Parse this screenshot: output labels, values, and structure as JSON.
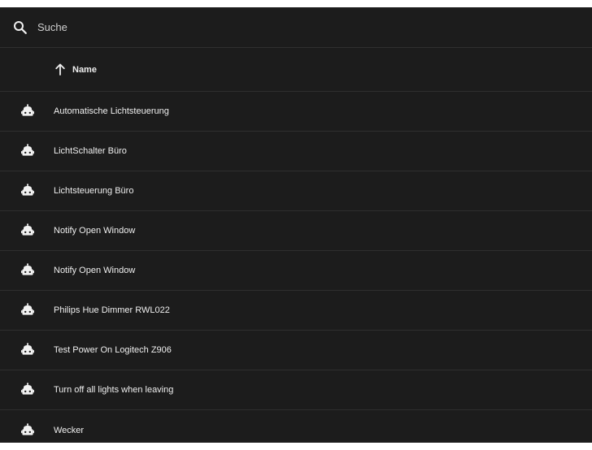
{
  "search": {
    "placeholder": "Suche"
  },
  "table": {
    "columns": [
      {
        "label": "Name",
        "sort": "ascending"
      }
    ],
    "rows": [
      {
        "name": "Automatische Lichtsteuerung",
        "icon": "robot-icon"
      },
      {
        "name": "LichtSchalter Büro",
        "icon": "robot-icon"
      },
      {
        "name": "Lichtsteuerung Büro",
        "icon": "robot-icon"
      },
      {
        "name": "Notify Open Window",
        "icon": "robot-icon"
      },
      {
        "name": "Notify Open Window",
        "icon": "robot-icon"
      },
      {
        "name": "Philips Hue Dimmer RWL022",
        "icon": "robot-icon"
      },
      {
        "name": "Test Power On Logitech Z906",
        "icon": "robot-icon"
      },
      {
        "name": "Turn off all lights when leaving",
        "icon": "robot-icon"
      },
      {
        "name": "Wecker",
        "icon": "robot-icon"
      }
    ]
  },
  "icons": {
    "search": "search-icon",
    "sort": "arrow-up-icon",
    "row": "robot-icon"
  },
  "colors": {
    "background": "#1c1c1c",
    "divider": "#2f2f2f",
    "text": "#efefef"
  }
}
